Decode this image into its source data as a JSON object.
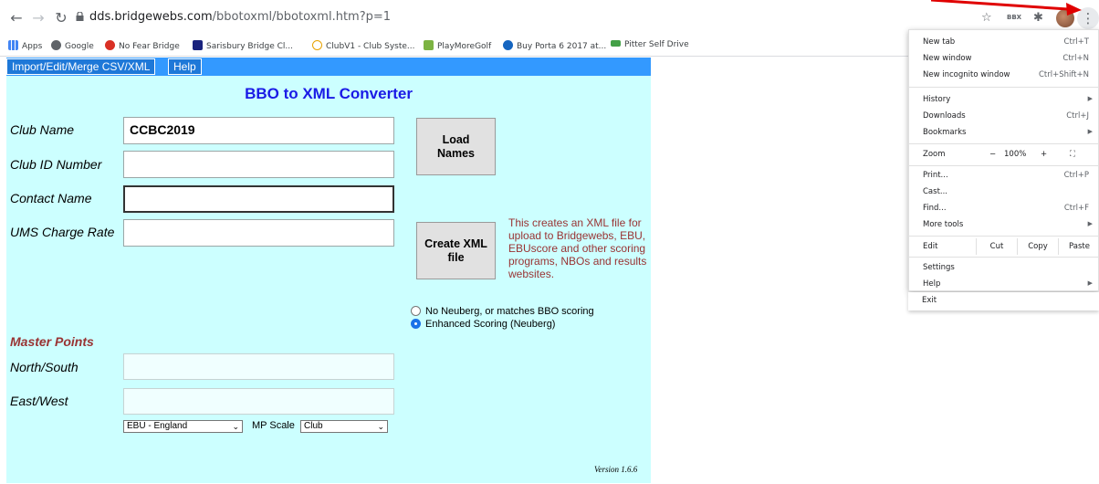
{
  "browser": {
    "url_host": "dds.bridgewebs.com",
    "url_path": "/bbotoxml/bbotoxml.htm?p=1",
    "ext_label": "BBX",
    "bookmarks": [
      {
        "label": "Apps",
        "color": "#4285f4"
      },
      {
        "label": "Google",
        "color": "#5f6368"
      },
      {
        "label": "No Fear Bridge",
        "color": "#d93025"
      },
      {
        "label": "Sarisbury Bridge Cl...",
        "color": "#1a237e"
      },
      {
        "label": "ClubV1 - Club Syste...",
        "color": "#e8a200"
      },
      {
        "label": "PlayMoreGolf",
        "color": "#7cb342"
      },
      {
        "label": "Buy Porta 6 2017 at...",
        "color": "#1565c0"
      },
      {
        "label": "Pitter Self Drive",
        "color": "#43a047"
      }
    ]
  },
  "menu": {
    "import_label": "Import/Edit/Merge CSV/XML",
    "help_label": "Help"
  },
  "form": {
    "title": "BBO to XML Converter",
    "club_name_label": "Club Name",
    "club_name_value": "CCBC2019",
    "club_id_label": "Club ID Number",
    "club_id_value": "",
    "contact_label": "Contact Name",
    "contact_value": "",
    "ums_label": "UMS Charge Rate",
    "ums_value": "",
    "load_names_label": "Load Names",
    "create_xml_label": "Create XML file",
    "note": "This creates an XML file for upload to Bridgewebs, EBU, EBUscore and other scoring programs, NBOs and results websites.",
    "radio_1": "No Neuberg, or matches BBO scoring",
    "radio_2": "Enhanced Scoring (Neuberg)",
    "master_points_heading": "Master Points",
    "ns_label": "North/South",
    "ew_label": "East/West",
    "ebu_select": "EBU - England",
    "mp_scale_label": "MP Scale",
    "mp_scale_select": "Club",
    "version": "Version 1.6.6"
  },
  "context_menu": {
    "new_tab": "New tab",
    "new_tab_sc": "Ctrl+T",
    "new_window": "New window",
    "new_window_sc": "Ctrl+N",
    "incognito": "New incognito window",
    "incognito_sc": "Ctrl+Shift+N",
    "history": "History",
    "downloads": "Downloads",
    "downloads_sc": "Ctrl+J",
    "bookmarks": "Bookmarks",
    "zoom": "Zoom",
    "zoom_minus": "−",
    "zoom_value": "100%",
    "zoom_plus": "+",
    "print": "Print...",
    "print_sc": "Ctrl+P",
    "cast": "Cast...",
    "find": "Find...",
    "find_sc": "Ctrl+F",
    "more_tools": "More tools",
    "edit": "Edit",
    "cut": "Cut",
    "copy": "Copy",
    "paste": "Paste",
    "settings": "Settings",
    "help": "Help",
    "exit": "Exit"
  }
}
